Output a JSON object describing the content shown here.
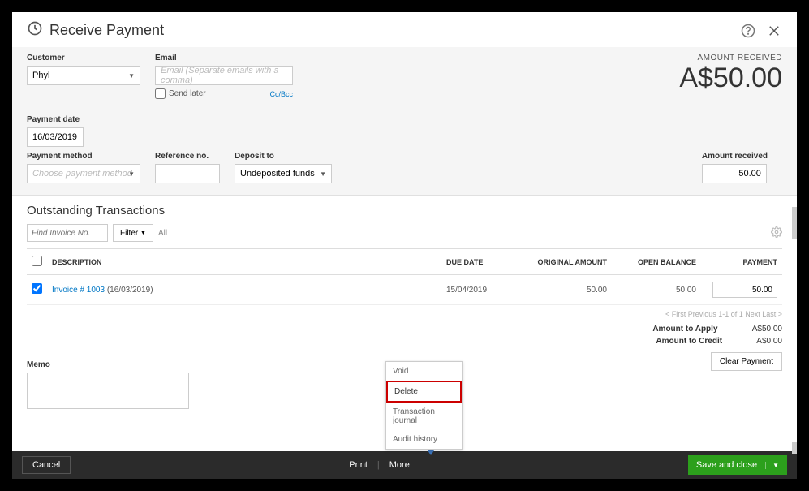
{
  "header": {
    "title": "Receive Payment"
  },
  "form": {
    "customer_label": "Customer",
    "customer_value": "Phyl",
    "email_label": "Email",
    "email_placeholder": "Email (Separate emails with a comma)",
    "send_later": "Send later",
    "ccbcc": "Cc/Bcc",
    "amount_received_label": "AMOUNT RECEIVED",
    "amount_received_value": "A$50.00",
    "payment_date_label": "Payment date",
    "payment_date_value": "16/03/2019",
    "payment_method_label": "Payment method",
    "payment_method_placeholder": "Choose payment method",
    "reference_label": "Reference no.",
    "reference_value": "",
    "deposit_label": "Deposit to",
    "deposit_value": "Undeposited funds",
    "amt_recv_field_label": "Amount received",
    "amt_recv_field_value": "50.00"
  },
  "outstanding": {
    "title": "Outstanding Transactions",
    "search_placeholder": "Find Invoice No.",
    "filter_label": "Filter",
    "all_label": "All",
    "columns": {
      "desc": "DESCRIPTION",
      "due": "DUE DATE",
      "orig": "ORIGINAL AMOUNT",
      "open": "OPEN BALANCE",
      "pay": "PAYMENT"
    },
    "rows": [
      {
        "checked": true,
        "link": "Invoice # 1003",
        "date": "(16/03/2019)",
        "due": "15/04/2019",
        "orig": "50.00",
        "open": "50.00",
        "pay": "50.00"
      }
    ],
    "pager": "< First   Previous   1-1 of 1   Next   Last >"
  },
  "totals": {
    "apply_label": "Amount to Apply",
    "apply_value": "A$50.00",
    "credit_label": "Amount to Credit",
    "credit_value": "A$0.00",
    "clear_label": "Clear Payment"
  },
  "memo_label": "Memo",
  "popup": {
    "void": "Void",
    "delete": "Delete",
    "journal": "Transaction journal",
    "audit": "Audit history"
  },
  "footer": {
    "cancel": "Cancel",
    "print": "Print",
    "more": "More",
    "save": "Save and close"
  }
}
